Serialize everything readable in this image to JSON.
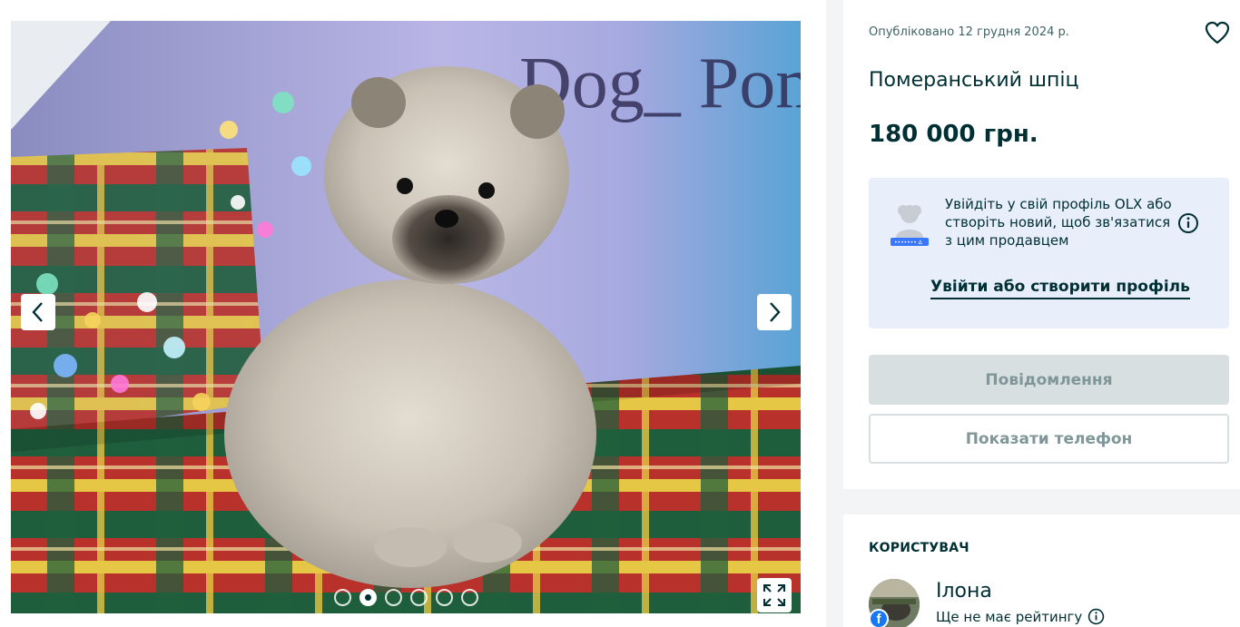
{
  "gallery": {
    "image_count": 6,
    "active_index": 1,
    "icons": {
      "prev": "chevron-left-icon",
      "next": "chevron-right-icon",
      "fullscreen": "expand-icon"
    },
    "photo_text": "Dog_ Pom"
  },
  "listing": {
    "posted": "Опубліковано 12 грудня 2024 р.",
    "title": "Померанський шпіц",
    "price": "180 000 грн.",
    "favorite_icon": "heart-icon"
  },
  "login_prompt": {
    "text": "Увійдіть у свій профіль OLX або створіть новий, щоб зв'язатися з цим продавцем",
    "link_label": "Увійти або створити профіль",
    "info_icon": "info-icon"
  },
  "actions": {
    "message_label": "Повідомлення",
    "phone_label": "Показати телефон"
  },
  "user": {
    "heading": "КОРИСТУВАЧ",
    "name": "Ілона",
    "rating": "Ще не має рейтингу",
    "badge_letter": "f"
  },
  "colors": {
    "brand_dark": "#002f34",
    "login_bg": "#e8effb",
    "disabled_btn": "#d8dfe0",
    "facebook": "#1877f2"
  }
}
